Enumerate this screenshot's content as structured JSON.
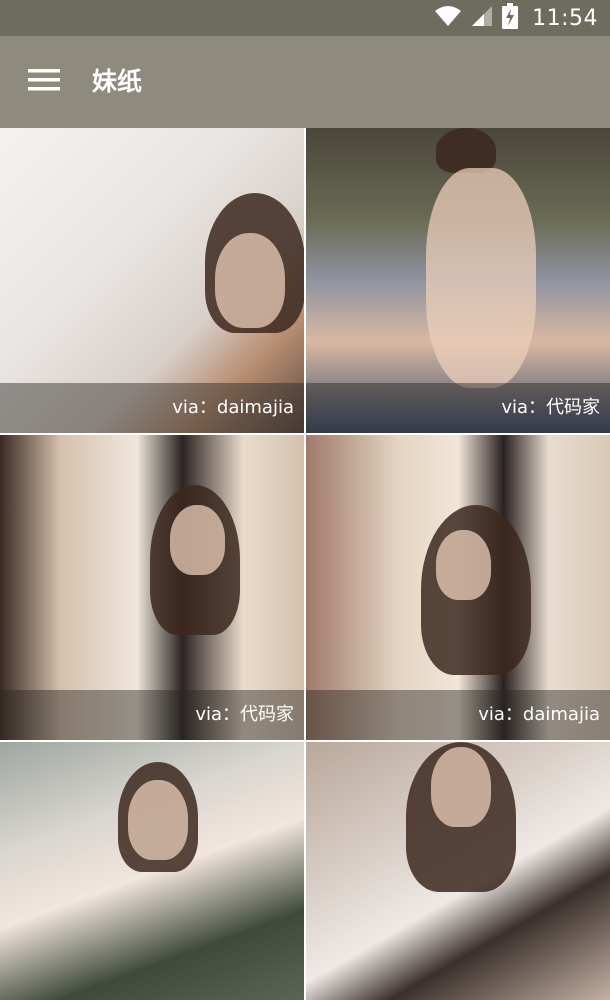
{
  "status_bar": {
    "time": "11:54",
    "icons": [
      "wifi-icon",
      "signal-icon",
      "battery-charging-icon"
    ]
  },
  "toolbar": {
    "menu_icon": "hamburger-menu-icon",
    "title": "妹纸"
  },
  "colors": {
    "status_bar": "#6e6b5f",
    "toolbar": "#8e8b7e",
    "caption_overlay": "rgba(40,38,34,0.45)"
  },
  "gallery": {
    "items": [
      {
        "caption": "via：daimajia"
      },
      {
        "caption": "via：代码家"
      },
      {
        "caption": "via：代码家"
      },
      {
        "caption": "via：daimajia"
      },
      {
        "caption": ""
      },
      {
        "caption": ""
      }
    ]
  }
}
